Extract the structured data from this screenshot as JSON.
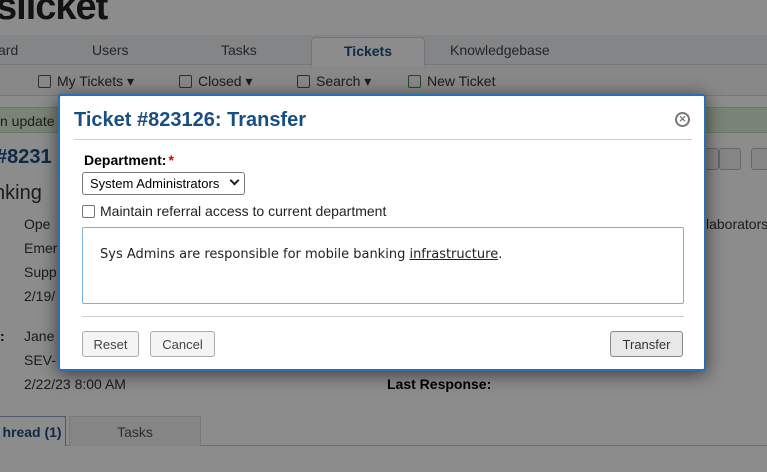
{
  "app": {
    "logo_text": "slicket"
  },
  "nav": {
    "tabs": [
      {
        "label": "ard"
      },
      {
        "label": "Users"
      },
      {
        "label": "Tasks"
      },
      {
        "label": "Tickets"
      },
      {
        "label": "Knowledgebase"
      }
    ]
  },
  "subnav": {
    "items": [
      {
        "label": "My Tickets ▾"
      },
      {
        "label": "Closed ▾"
      },
      {
        "label": "Search ▾"
      },
      {
        "label": "New Ticket"
      }
    ]
  },
  "notice": {
    "text": "n update"
  },
  "ticket": {
    "number": "#8231",
    "subject": "nking",
    "lines": [
      "Ope",
      "Emer",
      "Supp",
      "2/19/"
    ],
    "assignee_label": ":",
    "assignee": "Jane",
    "sla": "SEV-",
    "due": "2/22/23 8:00 AM",
    "last_response_label": "Last Response:",
    "collaborators": "laborators"
  },
  "bottom_tabs": [
    {
      "label": "hread (1)"
    },
    {
      "label": "Tasks"
    }
  ],
  "modal": {
    "title": "Ticket #823126: Transfer",
    "department_label": "Department:",
    "required_mark": "*",
    "department_value": "System Administrators",
    "referral_label": "Maintain referral access to current department",
    "note_before": "Sys Admins are responsible for mobile banking ",
    "note_link": "infrastructure",
    "note_after": ".",
    "reset_label": "Reset",
    "cancel_label": "Cancel",
    "transfer_label": "Transfer"
  },
  "colors": {
    "accent": "#184e81",
    "modal_border": "#2a6eb4",
    "notice_bg": "#dff0d8"
  }
}
